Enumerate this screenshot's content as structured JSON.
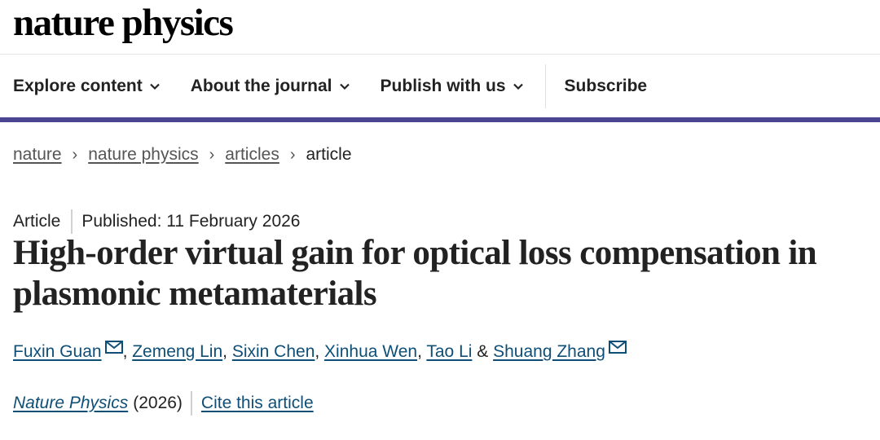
{
  "brand": {
    "name": "nature physics"
  },
  "nav": {
    "explore": "Explore content",
    "about": "About the journal",
    "publish": "Publish with us",
    "subscribe": "Subscribe"
  },
  "breadcrumb": {
    "items": [
      "nature",
      "nature physics",
      "articles"
    ],
    "current": "article"
  },
  "article": {
    "type": "Article",
    "published": "Published: 11 February 2026",
    "title": "High-order virtual gain for optical loss compensation in plasmonic metamaterials",
    "authors": [
      "Fuxin Guan",
      "Zemeng Lin",
      "Sixin Chen",
      "Xinhua Wen",
      "Tao Li",
      "Shuang Zhang"
    ],
    "author_separator": ", ",
    "author_last_joiner": " & ",
    "journal": "Nature Physics",
    "year": "(2026)",
    "cite": "Cite this article"
  },
  "colors": {
    "accent_bar": "#4c4591",
    "link": "#0f4f77"
  }
}
